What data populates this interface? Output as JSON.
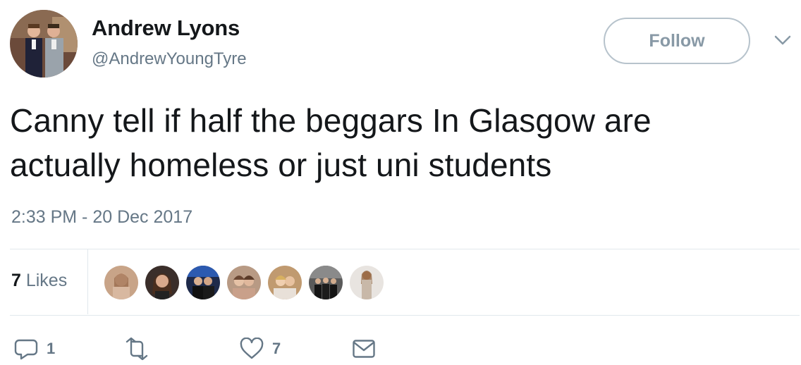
{
  "author": {
    "name": "Andrew Lyons",
    "handle": "@AndrewYoungTyre",
    "avatar_icon": "profile-photo-two-men-in-suits"
  },
  "follow_label": "Follow",
  "tweet": {
    "line1": "Canny tell if half the beggars In Glasgow are",
    "line2": "actually homeless or just uni students",
    "timestamp": "2:33 PM - 20 Dec 2017"
  },
  "likes": {
    "count": "7",
    "label": " Likes",
    "likers": [
      "liker-avatar-1",
      "liker-avatar-2",
      "liker-avatar-3",
      "liker-avatar-4",
      "liker-avatar-5",
      "liker-avatar-6",
      "liker-avatar-7"
    ]
  },
  "actions": {
    "replies": "1",
    "retweets": "",
    "likes": "7"
  },
  "colors": {
    "text": "#14171a",
    "secondary": "#657786",
    "divider": "#e1e8ed",
    "follow_border": "#b7c3cc"
  }
}
